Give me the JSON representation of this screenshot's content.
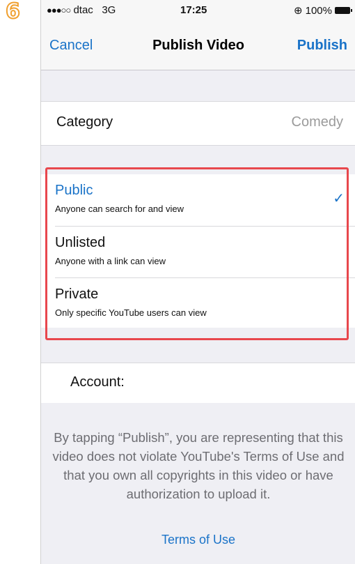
{
  "step_number": "6",
  "status_bar": {
    "signal_dots": "●●●○○",
    "carrier": "dtac",
    "network": "3G",
    "time": "17:25",
    "lock_symbol": "⊕",
    "battery": "100%"
  },
  "nav": {
    "cancel_label": "Cancel",
    "title": "Publish Video",
    "publish_label": "Publish"
  },
  "category": {
    "label": "Category",
    "value": "Comedy"
  },
  "privacy_options": [
    {
      "name": "Public",
      "description": "Anyone can search for and view",
      "selected": true
    },
    {
      "name": "Unlisted",
      "description": "Anyone with a link can view",
      "selected": false
    },
    {
      "name": "Private",
      "description": "Only specific YouTube users can view",
      "selected": false
    }
  ],
  "check_mark": "✓",
  "account": {
    "label": "Account:"
  },
  "footer": {
    "notice": "By tapping “Publish”, you are representing that this video does not violate YouTube's Terms of Use and that you own all copyrights in this video or have authorization to upload it.",
    "terms_link": "Terms of Use"
  },
  "colors": {
    "accent": "#1a73c8",
    "highlight": "#e8474d",
    "step_badge": "#f0a030"
  }
}
